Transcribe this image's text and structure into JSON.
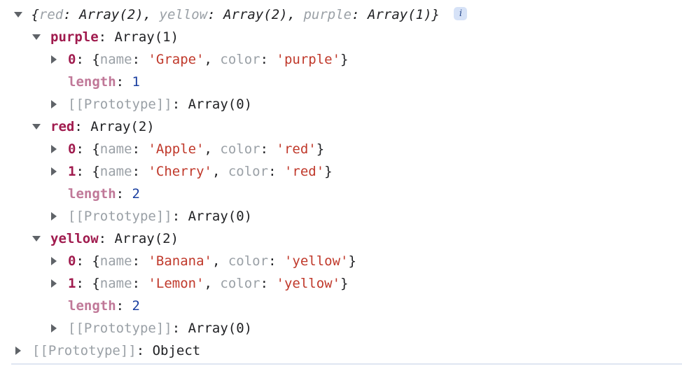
{
  "console": {
    "header": {
      "expander": "▼",
      "open_brace": "{",
      "entries": [
        {
          "key": "red",
          "value": "Array(2)"
        },
        {
          "key": "yellow",
          "value": "Array(2)"
        },
        {
          "key": "purple",
          "value": "Array(1)"
        }
      ],
      "separator": ", ",
      "close_brace": "}",
      "info_badge": "i"
    },
    "rows": [
      {
        "id": "purple-group",
        "indent": 1,
        "arrow": "open",
        "prop": "purple",
        "colon": ": ",
        "value": "Array(1)",
        "value_kind": "plain"
      },
      {
        "id": "purple-0",
        "indent": 2,
        "arrow": "closed",
        "prop": "0",
        "colon": ": ",
        "object_preview": {
          "open": "{",
          "fields": [
            {
              "key": "name",
              "value": "'Grape'"
            },
            {
              "key": "color",
              "value": "'purple'"
            }
          ],
          "close": "}"
        }
      },
      {
        "id": "purple-length",
        "indent": 2,
        "arrow": "none",
        "prop": "length",
        "prop_kind": "dim",
        "colon": ": ",
        "value": "1",
        "value_kind": "number"
      },
      {
        "id": "purple-prototype",
        "indent": 2,
        "arrow": "closed",
        "prop": "[[Prototype]]",
        "prop_kind": "internal",
        "colon": ": ",
        "value": "Array(0)",
        "value_kind": "plain"
      },
      {
        "id": "red-group",
        "indent": 1,
        "arrow": "open",
        "prop": "red",
        "colon": ": ",
        "value": "Array(2)",
        "value_kind": "plain"
      },
      {
        "id": "red-0",
        "indent": 2,
        "arrow": "closed",
        "prop": "0",
        "colon": ": ",
        "object_preview": {
          "open": "{",
          "fields": [
            {
              "key": "name",
              "value": "'Apple'"
            },
            {
              "key": "color",
              "value": "'red'"
            }
          ],
          "close": "}"
        }
      },
      {
        "id": "red-1",
        "indent": 2,
        "arrow": "closed",
        "prop": "1",
        "colon": ": ",
        "object_preview": {
          "open": "{",
          "fields": [
            {
              "key": "name",
              "value": "'Cherry'"
            },
            {
              "key": "color",
              "value": "'red'"
            }
          ],
          "close": "}"
        }
      },
      {
        "id": "red-length",
        "indent": 2,
        "arrow": "none",
        "prop": "length",
        "prop_kind": "dim",
        "colon": ": ",
        "value": "2",
        "value_kind": "number"
      },
      {
        "id": "red-prototype",
        "indent": 2,
        "arrow": "closed",
        "prop": "[[Prototype]]",
        "prop_kind": "internal",
        "colon": ": ",
        "value": "Array(0)",
        "value_kind": "plain"
      },
      {
        "id": "yellow-group",
        "indent": 1,
        "arrow": "open",
        "prop": "yellow",
        "colon": ": ",
        "value": "Array(2)",
        "value_kind": "plain"
      },
      {
        "id": "yellow-0",
        "indent": 2,
        "arrow": "closed",
        "prop": "0",
        "colon": ": ",
        "object_preview": {
          "open": "{",
          "fields": [
            {
              "key": "name",
              "value": "'Banana'"
            },
            {
              "key": "color",
              "value": "'yellow'"
            }
          ],
          "close": "}"
        }
      },
      {
        "id": "yellow-1",
        "indent": 2,
        "arrow": "closed",
        "prop": "1",
        "colon": ": ",
        "object_preview": {
          "open": "{",
          "fields": [
            {
              "key": "name",
              "value": "'Lemon'"
            },
            {
              "key": "color",
              "value": "'yellow'"
            }
          ],
          "close": "}"
        }
      },
      {
        "id": "yellow-length",
        "indent": 2,
        "arrow": "none",
        "prop": "length",
        "prop_kind": "dim",
        "colon": ": ",
        "value": "2",
        "value_kind": "number"
      },
      {
        "id": "yellow-prototype",
        "indent": 2,
        "arrow": "closed",
        "prop": "[[Prototype]]",
        "prop_kind": "internal",
        "colon": ": ",
        "value": "Array(0)",
        "value_kind": "plain"
      },
      {
        "id": "root-prototype",
        "indent": 0,
        "arrow": "closed",
        "prop": "[[Prototype]]",
        "prop_kind": "internal",
        "colon": ": ",
        "value": "Object",
        "value_kind": "plain"
      }
    ],
    "colors": {
      "property_name": "#a01b4e",
      "property_name_dim": "#c07898",
      "string_value": "#c0392b",
      "number_value": "#1a3fa0",
      "internal_property": "#9aa0a6",
      "plain_text": "#202124",
      "info_badge_bg": "#d6e2f7",
      "info_badge_fg": "#2a4b8d",
      "divider": "#dfe6f2",
      "background": "#ffffff"
    }
  }
}
